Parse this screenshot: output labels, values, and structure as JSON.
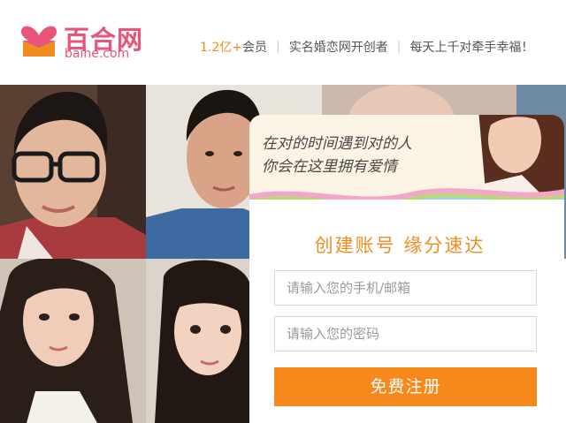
{
  "header": {
    "logo_cn": "百合网",
    "logo_en": "baihe.com",
    "slogan": {
      "count": "1.2亿+",
      "members": "会员",
      "item2": "实名婚恋网开创者",
      "item3": "每天上千对牵手幸福！",
      "separator": "|"
    }
  },
  "promo": {
    "line1": "在对的时间遇到对的人",
    "line2": "你会在这里拥有爱情"
  },
  "register": {
    "title": "创建账号   缘分速达",
    "phone_placeholder": "请输入您的手机/邮箱",
    "password_placeholder": "请输入您的密码",
    "button_label": "免费注册"
  },
  "colors": {
    "brand_pink": "#e8547a",
    "accent_orange": "#f7891c",
    "title_orange": "#f08c1e"
  },
  "icons": {
    "logo": "double-heart-logo-icon"
  }
}
